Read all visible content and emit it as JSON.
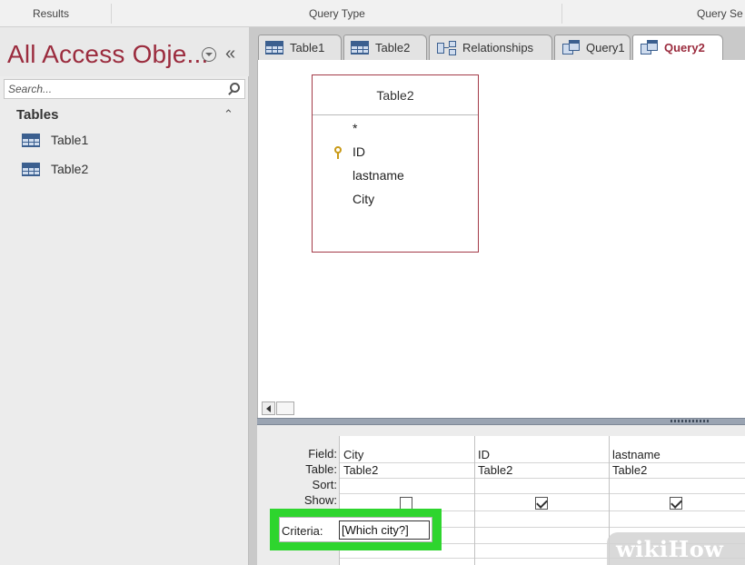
{
  "ribbon": {
    "groups": [
      "Results",
      "Query Type",
      "Query Se"
    ]
  },
  "nav_pane": {
    "title": "All Access Obje...",
    "collapse_symbol": "«",
    "search_placeholder": "Search...",
    "section": {
      "label": "Tables",
      "collapse_symbol": "≈",
      "items": [
        {
          "label": "Table1",
          "icon": "table-icon"
        },
        {
          "label": "Table2",
          "icon": "table-icon"
        }
      ]
    }
  },
  "document_tabs": [
    {
      "label": "Table1",
      "icon": "table-icon",
      "active": false
    },
    {
      "label": "Table2",
      "icon": "table-icon",
      "active": false
    },
    {
      "label": "Relationships",
      "icon": "relationships-icon",
      "active": false
    },
    {
      "label": "Query1",
      "icon": "query-icon",
      "active": false
    },
    {
      "label": "Query2",
      "icon": "query-icon",
      "active": true
    }
  ],
  "design_view": {
    "table": {
      "title": "Table2",
      "fields": [
        "*",
        "ID",
        "lastname",
        "City"
      ],
      "primary_key": "ID"
    }
  },
  "query_grid": {
    "row_labels": {
      "field": "Field:",
      "table": "Table:",
      "sort": "Sort:",
      "show": "Show:",
      "criteria": "Criteria:"
    },
    "columns": [
      {
        "field": "City",
        "table": "Table2",
        "show": false,
        "criteria": "[Which city?]"
      },
      {
        "field": "ID",
        "table": "Table2",
        "show": true,
        "criteria": ""
      },
      {
        "field": "lastname",
        "table": "Table2",
        "show": true,
        "criteria": ""
      }
    ]
  },
  "watermark": {
    "wiki": "wiki",
    "how": "How"
  },
  "colors": {
    "title_accent": "#9b2c3e",
    "highlight": "#2ed52e",
    "table_border": "#a33a48"
  }
}
